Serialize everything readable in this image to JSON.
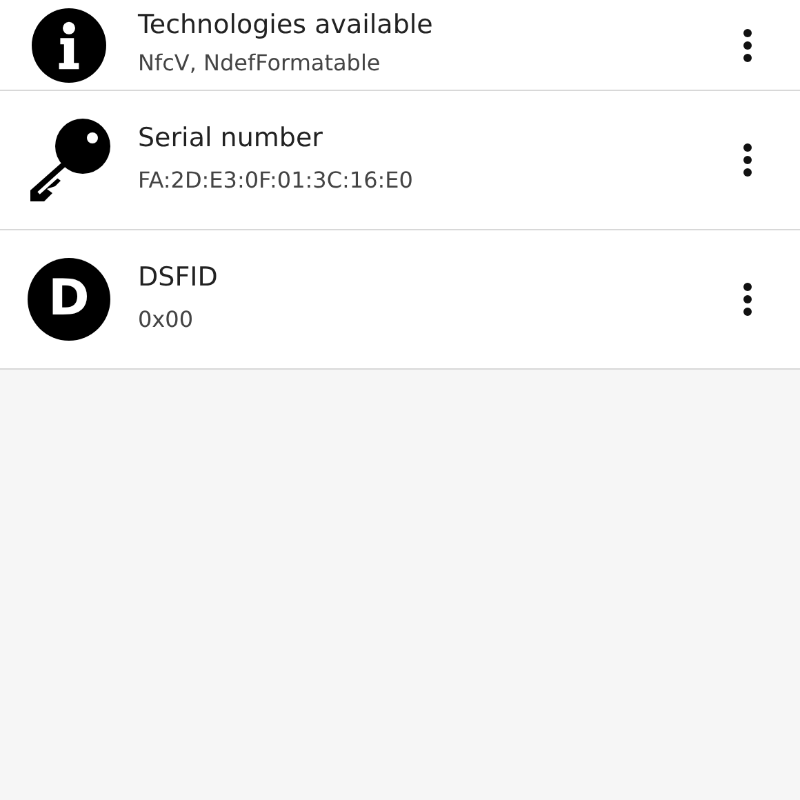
{
  "items": [
    {
      "kind": "info",
      "title": "Technologies available",
      "value": "NfcV, NdefFormatable"
    },
    {
      "kind": "key",
      "title": "Serial number",
      "value": "FA:2D:E3:0F:01:3C:16:E0"
    },
    {
      "kind": "letter",
      "icon_text": "D",
      "title": "DSFID",
      "value": "0x00"
    }
  ]
}
